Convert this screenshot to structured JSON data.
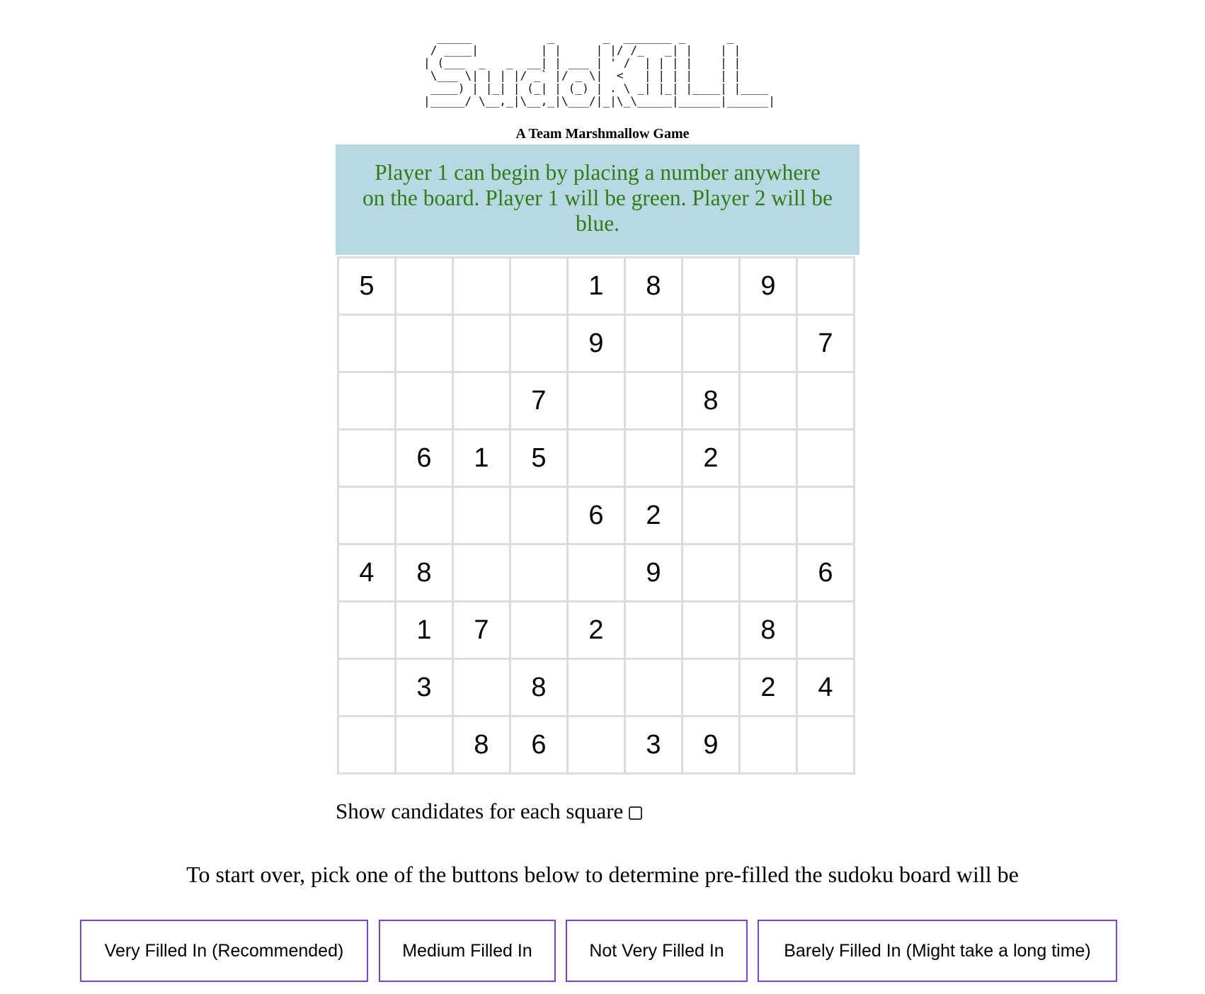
{
  "logo_ascii": "  _____           _       _  _______ _      _\n / ____|         | |     | |/ /_   _| |    | |\n| (___  _   _  __| | ___ | ' /  | | | |    | |\n \\___ \\| | | |/ _` |/ _ \\|  <   | | | |    | |\n ____) | |_| | (_| | (_) | . \\ _| |_| |____| |____\n|_____/ \\__,_|\\__,_|\\___/|_|\\_\\_____|______|______|",
  "subtitle": "A Team Marshmallow Game",
  "message": "Player 1 can begin by placing a number anywhere on the board. Player 1 will be green. Player 2 will be blue.",
  "colors": {
    "message_bg": "#b8d9e3",
    "message_text": "#2f7d14",
    "button_border": "#7b3fe4"
  },
  "board": [
    [
      "5",
      "",
      "",
      "",
      "1",
      "8",
      "",
      "9",
      ""
    ],
    [
      "",
      "",
      "",
      "",
      "9",
      "",
      "",
      "",
      "7"
    ],
    [
      "",
      "",
      "",
      "7",
      "",
      "",
      "8",
      "",
      ""
    ],
    [
      "",
      "6",
      "1",
      "5",
      "",
      "",
      "2",
      "",
      ""
    ],
    [
      "",
      "",
      "",
      "",
      "6",
      "2",
      "",
      "",
      ""
    ],
    [
      "4",
      "8",
      "",
      "",
      "",
      "9",
      "",
      "",
      "6"
    ],
    [
      "",
      "1",
      "7",
      "",
      "2",
      "",
      "",
      "8",
      ""
    ],
    [
      "",
      "3",
      "",
      "8",
      "",
      "",
      "",
      "2",
      "4"
    ],
    [
      "",
      "",
      "8",
      "6",
      "",
      "3",
      "9",
      "",
      ""
    ]
  ],
  "candidates": {
    "label": "Show candidates for each square",
    "checked": false
  },
  "restart_instruction": "To start over, pick one of the buttons below to determine pre-filled the sudoku board will be",
  "buttons": {
    "very_filled": "Very Filled In (Recommended)",
    "medium_filled": "Medium Filled In",
    "not_very_filled": "Not Very Filled In",
    "barely_filled": "Barely Filled In (Might take a long time)"
  }
}
